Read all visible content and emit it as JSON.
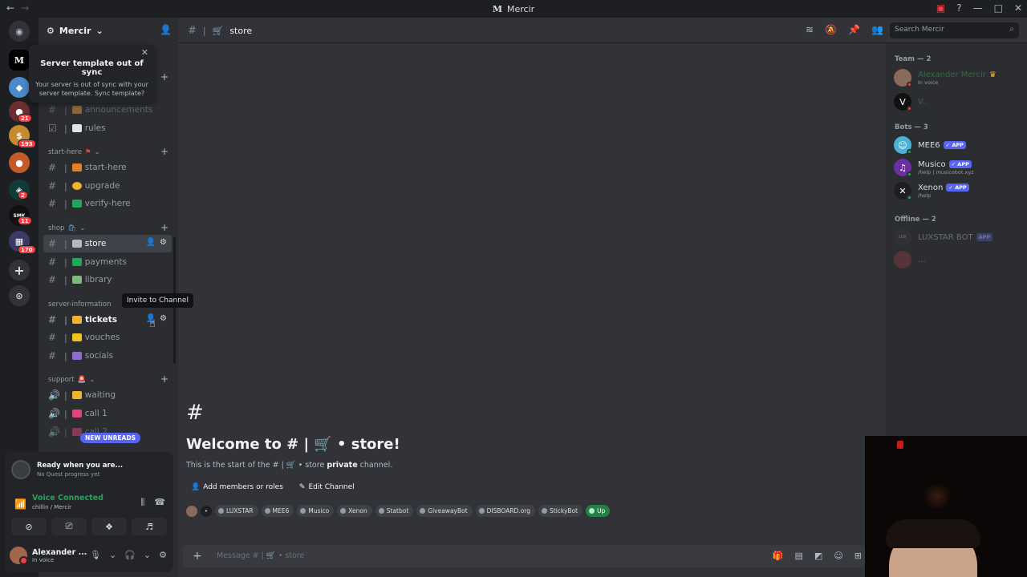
{
  "titlebar": {
    "title": "Mercir",
    "logo": "M"
  },
  "server": {
    "name": "Mercir"
  },
  "popup": {
    "title": "Server template out of sync",
    "body": "Your server is out of sync with your server template. Sync template?"
  },
  "categories": {
    "start_here": "start-here",
    "shop": "shop",
    "server_information": "server-information",
    "support": "support"
  },
  "channels": {
    "announcements": "announcements",
    "rules": "rules",
    "start_here": "start-here",
    "upgrade": "upgrade",
    "verify_here": "verify-here",
    "store": "store",
    "payments": "payments",
    "library": "library",
    "tickets": "tickets",
    "vouches": "vouches",
    "socials": "socials",
    "waiting": "waiting",
    "call1": "call 1",
    "call2": "call 2"
  },
  "tooltip": "Invite to Channel",
  "new_unreads": "NEW UNREADS",
  "guild_badges": [
    "21",
    "193",
    "2",
    "11",
    "170"
  ],
  "quest": {
    "title": "Ready when you are...",
    "subtitle": "No Quest progress yet"
  },
  "voice": {
    "status": "Voice Connected",
    "location": "chillin / Mercir"
  },
  "user": {
    "name": "Alexander ...",
    "status": "In voice"
  },
  "header": {
    "channel": "store",
    "search_placeholder": "Search Mercir"
  },
  "welcome": {
    "title": "Welcome to # | 🛒 • store!",
    "subtitle_pre": "This is the start of the # | 🛒 • store ",
    "subtitle_bold": "private",
    "subtitle_post": " channel.",
    "add_members": "Add members or roles",
    "edit_channel": "Edit Channel"
  },
  "chips": [
    "LUXSTAR",
    "MEE6",
    "Musico",
    "Xenon",
    "Statbot",
    "GiveawayBot",
    "DISBOARD.org",
    "StickyBot",
    "Up"
  ],
  "composer": {
    "placeholder": "Message # | 🛒 • store"
  },
  "members": {
    "team_header": "Team — 2",
    "bots_header": "Bots — 3",
    "offline_header": "Offline — 2",
    "team": [
      {
        "name": "Alexander Mercir",
        "sub": "In voice"
      },
      {
        "name": "V..",
        "sub": ""
      }
    ],
    "bots": [
      {
        "name": "MEE6",
        "tag": "APP",
        "sub": ""
      },
      {
        "name": "Musico",
        "tag": "APP",
        "sub": "/help | musicobot.xyz"
      },
      {
        "name": "Xenon",
        "tag": "APP",
        "sub": "/help"
      }
    ],
    "offline": [
      {
        "name": "LUXSTAR BOT",
        "tag": "APP"
      },
      {
        "name": "..."
      }
    ]
  },
  "colors": {
    "accent": "#5865f2",
    "online": "#23a55a",
    "danger": "#f23f43"
  }
}
